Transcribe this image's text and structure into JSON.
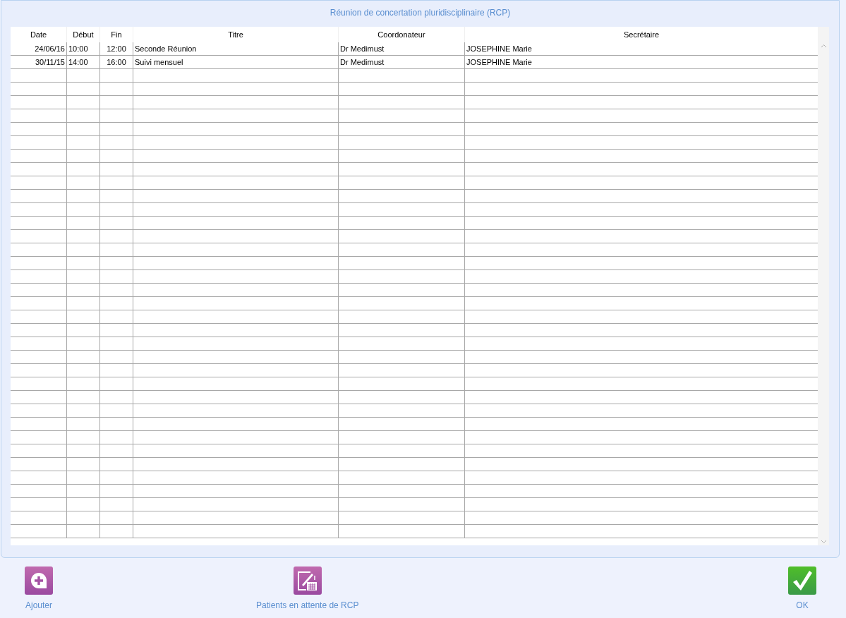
{
  "title": "Réunion de concertation pluridisciplinaire (RCP)",
  "table": {
    "columns": [
      "Date",
      "Début",
      "Fin",
      "Titre",
      "Coordonateur",
      "Secrétaire"
    ],
    "rows": [
      [
        "24/06/16",
        "10:00",
        "12:00",
        "Seconde Réunion",
        "Dr Medimust",
        "JOSEPHINE Marie"
      ],
      [
        "30/11/15",
        "14:00",
        "16:00",
        "Suivi mensuel",
        "Dr Medimust",
        "JOSEPHINE Marie"
      ]
    ]
  },
  "buttons": [
    {
      "kind": "add",
      "label": "Ajouter"
    },
    {
      "kind": "waiting",
      "label": "Patients en attente de RCP"
    },
    {
      "kind": "ok",
      "label": "OK"
    }
  ]
}
